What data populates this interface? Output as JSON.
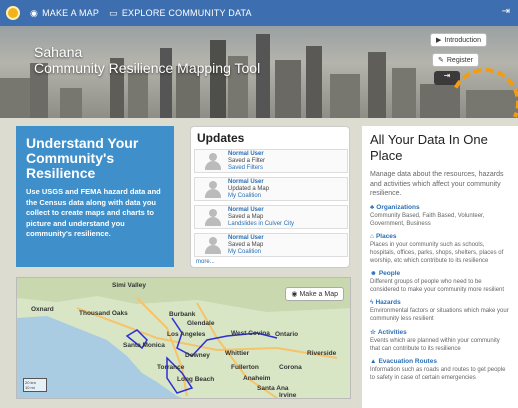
{
  "nav": {
    "make_map": "MAKE A MAP",
    "explore": "EXPLORE COMMUNITY DATA"
  },
  "hero": {
    "title_line1": "Sahana",
    "title_line2": "Community Resilience Mapping Tool",
    "introduction": "Introduction",
    "register": "Register"
  },
  "intro_panel": {
    "heading": "Understand Your Community's Resilience",
    "body": "Use USGS and FEMA hazard data and the Census data along with data you collect to create maps and charts to picture and understand you community's resilience."
  },
  "updates": {
    "title": "Updates",
    "items": [
      {
        "user": "Normal User",
        "action": "Saved a Filter",
        "link": "Saved Filters"
      },
      {
        "user": "Normal User",
        "action": "Updated a Map",
        "link": "My Coalition"
      },
      {
        "user": "Normal User",
        "action": "Saved a Map",
        "link": "Landslides in Culver City"
      },
      {
        "user": "Normal User",
        "action": "Saved a Map",
        "link": "My Coalition"
      }
    ],
    "more": "more..."
  },
  "map": {
    "button": "Make a Map",
    "cities": [
      "Simi Valley",
      "Oxnard",
      "Thousand Oaks",
      "Burbank",
      "Glendale",
      "Los Angeles",
      "West Covina",
      "Ontario",
      "Santa Monica",
      "Downey",
      "Whittier",
      "Riverside",
      "Torrance",
      "Long Beach",
      "Fullerton",
      "Corona",
      "Anaheim",
      "Santa Ana",
      "Irvine"
    ],
    "scale_km": "20 km",
    "scale_mi": "10 mi"
  },
  "all_data": {
    "title": "All Your Data In One Place",
    "lead": "Manage data about the resources, hazards and activities which affect your community resilience.",
    "sections": [
      {
        "title": "Organizations",
        "desc": "Community Based, Faith Based, Volunteer, Government, Business"
      },
      {
        "title": "Places",
        "desc": "Places in your community such as schools, hospitals, offices, parks, shops, shelters, places of worship, etc which contribute to its resilience"
      },
      {
        "title": "People",
        "desc": "Different groups of people who need to be considered to make your community more resilient"
      },
      {
        "title": "Hazards",
        "desc": "Environmental factors or situations which make your community less resilient"
      },
      {
        "title": "Activities",
        "desc": "Events which are planned within your community that can contribute to its resilience"
      },
      {
        "title": "Evacuation Routes",
        "desc": "Information such as roads and routes to get people to safety in case of certain emergencies"
      }
    ]
  },
  "colors": {
    "topbar": "#3d6fb0",
    "blue_panel": "#3f8fcb",
    "link": "#2a6fb5",
    "accent_orange": "#f39c12"
  }
}
